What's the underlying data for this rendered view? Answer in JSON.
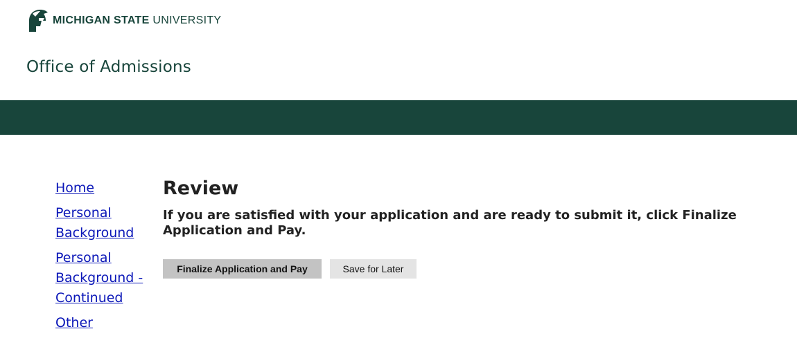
{
  "header": {
    "wordmark_bold": "MICHIGAN STATE",
    "wordmark_light": "UNIVERSITY",
    "office_title": "Office of Admissions"
  },
  "colors": {
    "brand_green": "#18453b",
    "link_blue": "#0b17b8"
  },
  "sidebar": {
    "items": [
      {
        "label": "Home"
      },
      {
        "label": "Personal Background"
      },
      {
        "label": "Personal Background - Continued"
      },
      {
        "label": "Other"
      }
    ]
  },
  "main": {
    "title": "Review",
    "instructions": "If you are satisfied with your application and are ready to submit it, click Finalize Application and Pay.",
    "finalize_label": "Finalize Application and Pay",
    "save_label": "Save for Later"
  }
}
